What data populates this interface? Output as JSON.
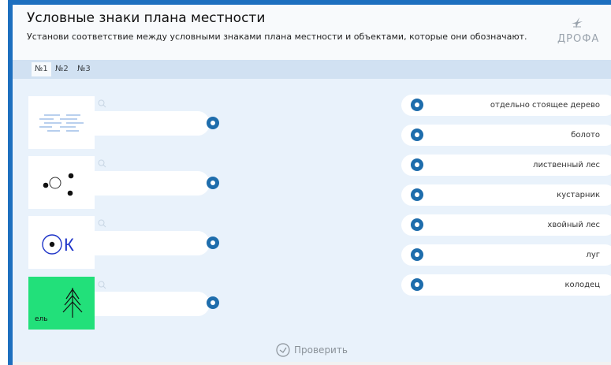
{
  "header": {
    "title": "Условные знаки плана местности",
    "subtitle": "Установи соответствие между условными знаками плана местности и объектами, которые они обозначают.",
    "logo_text": "ДРОФА"
  },
  "tabs": [
    {
      "label": "№1",
      "active": true
    },
    {
      "label": "№2",
      "active": false
    },
    {
      "label": "№3",
      "active": false
    }
  ],
  "symbols": [
    {
      "icon": "water-lines-icon",
      "label": ""
    },
    {
      "icon": "dots-circle-icon",
      "label": ""
    },
    {
      "icon": "well-icon",
      "label": "К"
    },
    {
      "icon": "spruce-icon",
      "label": "ель"
    }
  ],
  "options": [
    {
      "label": "отдельно стоящее дерево"
    },
    {
      "label": "болото"
    },
    {
      "label": "лиственный лес"
    },
    {
      "label": "кустарник"
    },
    {
      "label": "хвойный лес"
    },
    {
      "label": "луг"
    },
    {
      "label": "колодец"
    }
  ],
  "check_button": {
    "label": "Проверить"
  },
  "colors": {
    "frame": "#1d6fbf",
    "ring": "#1e6dac",
    "spruce_bg": "#22e07a",
    "well_letter": "#1f35c8"
  }
}
